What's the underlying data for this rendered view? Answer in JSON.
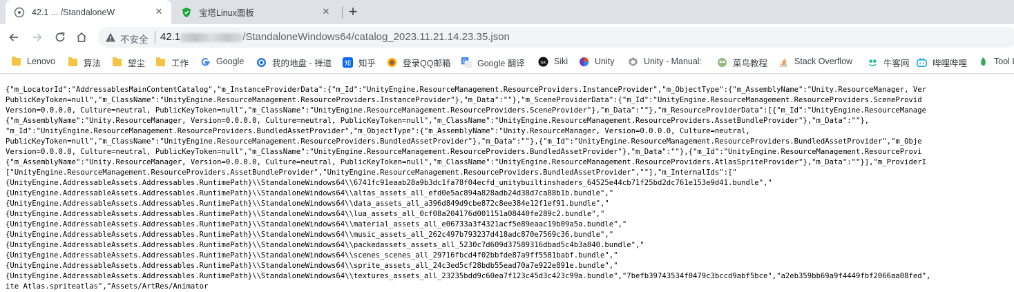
{
  "tabs": [
    {
      "title": "42.1 ... /StandaloneW",
      "favicon": "globe-icon"
    },
    {
      "title": "宝塔Linux面板",
      "favicon": "shield-icon"
    }
  ],
  "toolbar": {
    "insecure_label": "不安全",
    "url_host": "42.1",
    "url_path": "/StandaloneWindows64/catalog_2023.11.21.14.23.35.json"
  },
  "bookmarks": [
    {
      "label": "Lenovo",
      "icon": "folder-icon"
    },
    {
      "label": "算法",
      "icon": "folder-icon"
    },
    {
      "label": "望尘",
      "icon": "folder-icon"
    },
    {
      "label": "工作",
      "icon": "folder-icon"
    },
    {
      "label": "Google",
      "icon": "google-icon"
    },
    {
      "label": "我的地盘 - 禅道",
      "icon": "zentao-icon"
    },
    {
      "label": "知乎",
      "icon": "zhihu-icon"
    },
    {
      "label": "登录QQ邮箱",
      "icon": "qqmail-icon"
    },
    {
      "label": "Google 翻译",
      "icon": "translate-icon"
    },
    {
      "label": "Siki",
      "icon": "siki-icon"
    },
    {
      "label": "Unity",
      "icon": "unity-icon"
    },
    {
      "label": "Unity - Manual:",
      "icon": "unity-manual-icon"
    },
    {
      "label": "菜鸟教程",
      "icon": "runoob-icon"
    },
    {
      "label": "Stack Overflow",
      "icon": "stackoverflow-icon"
    },
    {
      "label": "牛客网",
      "icon": "nowcoder-icon"
    },
    {
      "label": "哔哩哔哩",
      "icon": "bilibili-icon"
    },
    {
      "label": "Tool L",
      "icon": "tool-icon"
    }
  ],
  "content_lines": [
    "{\"m_LocatorId\":\"AddressablesMainContentCatalog\",\"m_InstanceProviderData\":{\"m_Id\":\"UnityEngine.ResourceManagement.ResourceProviders.InstanceProvider\",\"m_ObjectType\":{\"m_AssemblyName\":\"Unity.ResourceManager, Ver",
    "PublicKeyToken=null\",\"m_ClassName\":\"UnityEngine.ResourceManagement.ResourceProviders.InstanceProvider\"},\"m_Data\":\"\"},\"m_SceneProviderData\":{\"m_Id\":\"UnityEngine.ResourceManagement.ResourceProviders.SceneProvid",
    "Version=0.0.0.0, Culture=neutral, PublicKeyToken=null\",\"m_ClassName\":\"UnityEngine.ResourceManagement.ResourceProviders.SceneProvider\"},\"m_Data\":\"\"},\"m_ResourceProviderData\":[{\"m_Id\":\"UnityEngine.ResourceManage",
    "{\"m_AssemblyName\":\"Unity.ResourceManager, Version=0.0.0.0, Culture=neutral, PublicKeyToken=null\",\"m_ClassName\":\"UnityEngine.ResourceManagement.ResourceProviders.AssetBundleProvider\"},\"m_Data\":\"\"},",
    "\"m_Id\":\"UnityEngine.ResourceManagement.ResourceProviders.BundledAssetProvider\",\"m_ObjectType\":{\"m_AssemblyName\":\"Unity.ResourceManager, Version=0.0.0.0, Culture=neutral,",
    "PublicKeyToken=null\",\"m_ClassName\":\"UnityEngine.ResourceManagement.ResourceProviders.BundledAssetProvider\"},\"m_Data\":\"\"},{\"m_Id\":\"UnityEngine.ResourceManagement.ResourceProviders.BundledAssetProvider\",\"m_Obje",
    "Version=0.0.0.0, Culture=neutral, PublicKeyToken=null\",\"m_ClassName\":\"UnityEngine.ResourceManagement.ResourceProviders.BundledAssetProvider\"},\"m_Data\":\"\"},{\"m_Id\":\"UnityEngine.ResourceManagement.ResourceProvi",
    "{\"m_AssemblyName\":\"Unity.ResourceManager, Version=0.0.0.0, Culture=neutral, PublicKeyToken=null\",\"m_ClassName\":\"UnityEngine.ResourceManagement.ResourceProviders.AtlasSpriteProvider\"},\"m_Data\":\"\"}],\"m_ProviderI",
    "[\"UnityEngine.ResourceManagement.ResourceProviders.AssetBundleProvider\",\"UnityEngine.ResourceManagement.ResourceProviders.BundledAssetProvider\",\"\"],\"m_InternalIds\":[\"",
    "{UnityEngine.AddressableAssets.Addressables.RuntimePath}\\\\StandaloneWindows64\\\\6741fc91eaab28a9b3dc1fa78f04ecfd_unitybuiltinshaders_64525e44cb71f25bd2dc761e153e9d41.bundle\",\"",
    "{UnityEngine.AddressableAssets.Addressables.RuntimePath}\\\\StandaloneWindows64\\\\altas_assets_all_efd0e5ac894a828adb24d38d7ca88b1b.bundle\",\"",
    "{UnityEngine.AddressableAssets.Addressables.RuntimePath}\\\\StandaloneWindows64\\\\data_assets_all_a396d849d9cbe872c8ee384e12f1ef91.bundle\",\"",
    "{UnityEngine.AddressableAssets.Addressables.RuntimePath}\\\\StandaloneWindows64\\\\lua_assets_all_0cf08a204176d001151a08440fe289c2.bundle\",\"",
    "{UnityEngine.AddressableAssets.Addressables.RuntimePath}\\\\StandaloneWindows64\\\\material_assets_all_e06733a3f4321acf5e89eaac19b09a5a.bundle\",\"",
    "{UnityEngine.AddressableAssets.Addressables.RuntimePath}\\\\StandaloneWindows64\\\\music_assets_all_262c497b793237d418adc870e7569c36.bundle\",\"",
    "{UnityEngine.AddressableAssets.Addressables.RuntimePath}\\\\StandaloneWindows64\\\\packedassets_assets_all_5230c7d609d37589316dbad5c4b3a840.bundle\",\"",
    "{UnityEngine.AddressableAssets.Addressables.RuntimePath}\\\\StandaloneWindows64\\\\scenes_scenes_all_29716fbcd4f02bbfde87a9ff5581babf.bundle\",\"",
    "{UnityEngine.AddressableAssets.Addressables.RuntimePath}\\\\StandaloneWindows64\\\\sprite_assets_all_24c3ed5cf28bdb55ead70a7e922e891e.bundle\",\"",
    "{UnityEngine.AddressableAssets.Addressables.RuntimePath}\\\\StandaloneWindows64\\\\textures_assets_all_23235bdd9c60ea7f123c45d3c423c99a.bundle\",\"7befb39743534f0479c3bccd9abf5bce\",\"a2eb359bb69a9f4449fbf2066aa08fed\",",
    "ite Atlas.spriteatlas\",\"Assets/ArtRes/Animator"
  ]
}
